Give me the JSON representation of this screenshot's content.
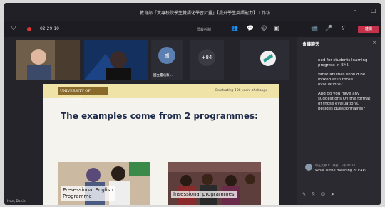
{
  "window": {
    "title": "教育部「大專校院學生雙語化學習計畫」【提升學生英語能力】工作坊",
    "time": "02:29:10",
    "hide_label": "隱藏控制",
    "leave_label": "離開"
  },
  "participants": [
    {
      "name": "",
      "initials": ""
    },
    {
      "name": "",
      "initials": ""
    },
    {
      "name": "國立臺北教...",
      "initials": "國"
    },
    {
      "name": "",
      "initials": "+84"
    }
  ],
  "slide": {
    "logo_text": "UNIVERSITY OF LEICESTER",
    "tagline": "Celebrating 100 years of change",
    "title": "The examples come from 2 programmes:",
    "photo1_label_line1": "Presessional English",
    "photo1_label_line2": "Programme",
    "photo2_label": "Insessional programmes"
  },
  "presenter_name": "Ivan, Daniel",
  "chat": {
    "title": "會議聊天",
    "messages": [
      "ned for students learning progress in EMI.",
      "What abilities should be looked at in those evaluations?",
      "And do you have any suggestions On the format of those evaluations, besides questionnaires?"
    ],
    "msg2_meta": "中正大學Dr. (來賓)  下午 02:24",
    "msg2_text": "What is the meaning of EAP?"
  }
}
